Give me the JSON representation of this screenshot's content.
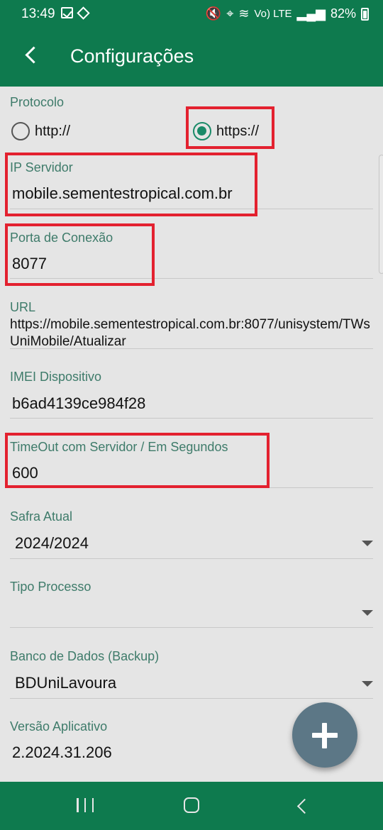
{
  "status_bar": {
    "time": "13:49",
    "battery": "82%",
    "signal_label": "Vo) LTE"
  },
  "app_bar": {
    "title": "Configurações"
  },
  "form": {
    "protocol": {
      "label": "Protocolo",
      "options": [
        "http://",
        "https://"
      ],
      "selected": "https://"
    },
    "ip_server": {
      "label": "IP Servidor",
      "value": "mobile.sementestropical.com.br"
    },
    "port": {
      "label": "Porta de Conexão",
      "value": "8077"
    },
    "url": {
      "label": "URL",
      "value": "https://mobile.sementestropical.com.br:8077/unisystem/TWsUniMobile/Atualizar"
    },
    "imei": {
      "label": "IMEI Dispositivo",
      "value": "b6ad4139ce984f28"
    },
    "timeout": {
      "label": "TimeOut com Servidor / Em Segundos",
      "value": "600"
    },
    "safra": {
      "label": "Safra Atual",
      "value": "2024/2024"
    },
    "tipo_processo": {
      "label": "Tipo Processo",
      "value": ""
    },
    "banco": {
      "label": "Banco de Dados (Backup)",
      "value": "BDUniLavoura"
    },
    "versao": {
      "label": "Versão Aplicativo",
      "value": "2.2024.31.206"
    }
  },
  "colors": {
    "primary": "#0e7a4e",
    "accent": "#1a8a68",
    "label": "#3e7b6a",
    "highlight": "#e3212f",
    "fab": "#5c7786"
  }
}
